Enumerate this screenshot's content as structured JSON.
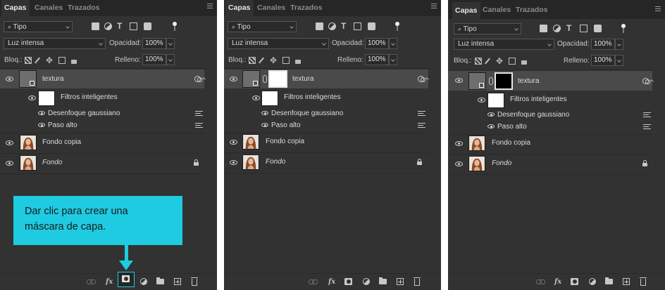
{
  "panels": [
    {
      "tabs": [
        "Capas",
        "Canales",
        "Trazados"
      ],
      "filter": "Tipo",
      "blend_mode": "Luz intensa",
      "opacity_label": "Opacidad:",
      "opacity_value": "100%",
      "lock_label": "Bloq.:",
      "fill_label": "Relleno:",
      "fill_value": "100%",
      "layers": {
        "textura": "textura",
        "smart_filters": "Filtros inteligentes",
        "filter1": "Desenfoque gaussiano",
        "filter2": "Paso alto",
        "fondo_copia": "Fondo copia",
        "fondo": "Fondo"
      }
    },
    {
      "tabs": [
        "Capas",
        "Canales",
        "Trazados"
      ],
      "filter": "Tipo",
      "blend_mode": "Luz intensa",
      "opacity_label": "Opacidad:",
      "opacity_value": "100%",
      "lock_label": "Bloq.:",
      "fill_label": "Relleno:",
      "fill_value": "100%",
      "layers": {
        "textura": "textura",
        "smart_filters": "Filtros inteligentes",
        "filter1": "Desenfoque gaussiano",
        "filter2": "Paso alto",
        "fondo_copia": "Fondo copia",
        "fondo": "Fondo"
      }
    },
    {
      "tabs": [
        "Capas",
        "Canales",
        "Trazados"
      ],
      "filter": "Tipo",
      "blend_mode": "Luz intensa",
      "opacity_label": "Opacidad:",
      "opacity_value": "100%",
      "lock_label": "Bloq.:",
      "fill_label": "Relleno:",
      "fill_value": "100%",
      "layers": {
        "textura": "textura",
        "smart_filters": "Filtros inteligentes",
        "filter1": "Desenfoque gaussiano",
        "filter2": "Paso alto",
        "fondo_copia": "Fondo copia",
        "fondo": "Fondo"
      }
    }
  ],
  "footer": {
    "fx_label": "fx"
  },
  "callout": {
    "line1": "Dar clic para crear una",
    "line2": "máscara de capa."
  },
  "colors": {
    "panel_bg": "#323232",
    "tab_bar_bg": "#262626",
    "selected_row": "#4a4a4a",
    "accent_callout": "#1ecbe1",
    "mask_white": "#ffffff",
    "mask_black": "#000000"
  },
  "icons": [
    "search-icon",
    "image-filter-icon",
    "adjustment-filter-icon",
    "type-filter-icon",
    "shape-filter-icon",
    "smart-object-filter-icon",
    "filter-toggle-icon",
    "lock-pixels-icon",
    "brush-lock-icon",
    "move-lock-icon",
    "artboard-lock-icon",
    "lock-all-icon",
    "eye-icon",
    "link-icon",
    "fx-icon",
    "layer-mask-icon",
    "adjustment-layer-icon",
    "folder-icon",
    "new-layer-icon",
    "trash-icon",
    "panel-menu-icon"
  ]
}
